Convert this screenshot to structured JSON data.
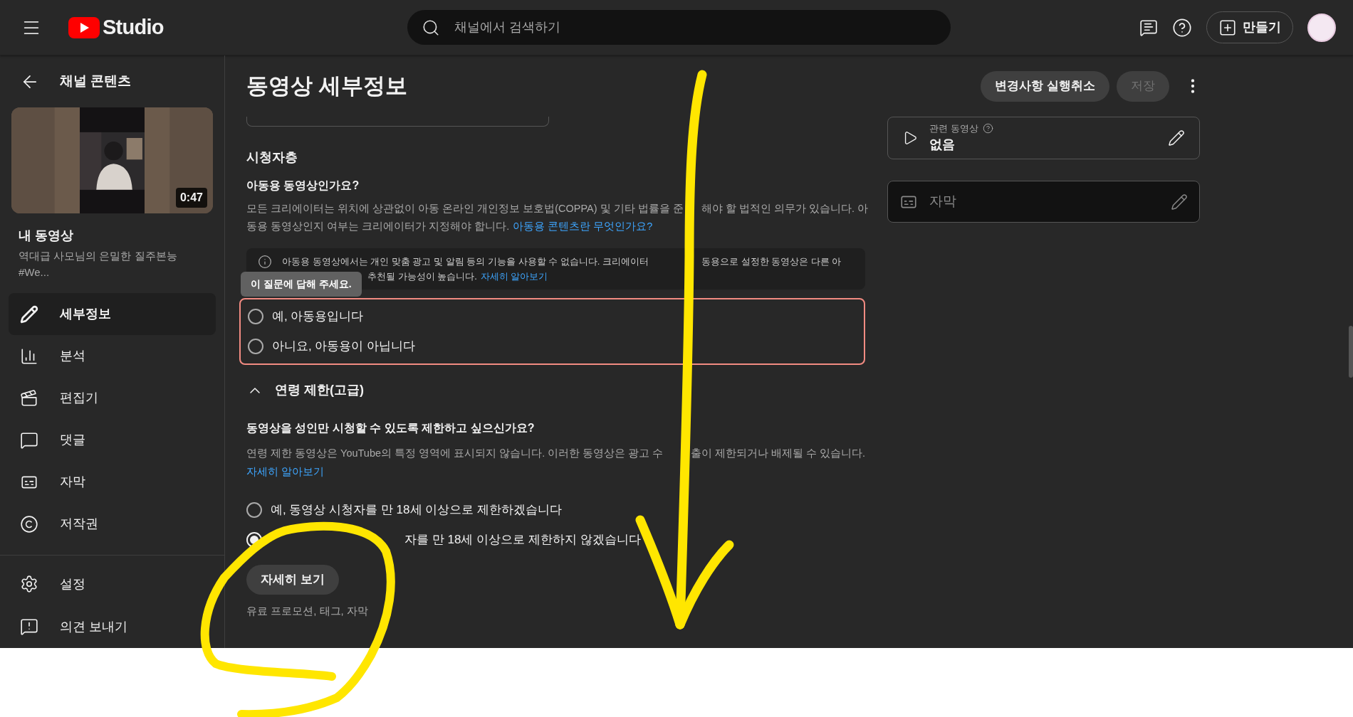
{
  "header": {
    "logo_text": "Studio",
    "search": {
      "placeholder": "채널에서 검색하기"
    },
    "create_button": "만들기"
  },
  "sidebar": {
    "back_label": "채널 콘텐츠",
    "thumbnail": {
      "kind": "picture",
      "duration": "0:47"
    },
    "video_heading": "내 동영상",
    "video_title": "역대급 사모님의 은밀한 질주본능 #We...",
    "nav": [
      {
        "label": "세부정보",
        "selected": true
      },
      {
        "label": "분석",
        "selected": false
      },
      {
        "label": "편집기",
        "selected": false
      },
      {
        "label": "댓글",
        "selected": false
      },
      {
        "label": "자막",
        "selected": false
      },
      {
        "label": "저작권",
        "selected": false
      }
    ],
    "footer_nav": [
      {
        "label": "설정"
      },
      {
        "label": "의견 보내기"
      }
    ]
  },
  "page": {
    "title": "동영상 세부정보",
    "undo_button": "변경사항 실행취소",
    "save_button": {
      "label": "저장",
      "disabled": true
    }
  },
  "audience": {
    "heading": "시청자층",
    "question": "아동용 동영상인가요?",
    "description_parts": [
      "모든 크리에이터는 위치에 상관없이 아동 온라인 개인정보 보호법(COPPA) 및 기타 법률을 준",
      "해야 할 법적인 의무가 있습니다. 아",
      "동용 동영상인지 여부는 크리에이터가 지정해야 합니다."
    ],
    "link": "아동용 콘텐츠란 무엇인가요?",
    "info": {
      "text_parts": [
        "아동용 동영상에서는 개인 맞춤 광고 및 알림 등의 기능을 사용할 수 없습니다. 크리에이터",
        "동용으로 설정한 동영상은 다른 아",
        "추천될 가능성이 높습니다."
      ],
      "link": "자세히 알아보기"
    },
    "tooltip": "이 질문에 답해 주세요.",
    "error": true,
    "options": [
      {
        "label": "예, 아동용입니다",
        "selected": false
      },
      {
        "label": "아니요, 아동용이 아닙니다",
        "selected": false
      }
    ]
  },
  "age_restriction": {
    "heading": "연령 제한(고급)",
    "expanded": true,
    "question": "동영상을 성인만 시청할 수 있도록 제한하고 싶으신가요?",
    "description_parts": [
      "연령 제한 동영상은 YouTube의 특정 영역에 표시되지 않습니다. 이러한 동영상은 광고 수",
      "출이 제한되거나 배제될 수 있습니다."
    ],
    "link": "자세히 알아보기",
    "options": [
      {
        "label": "예, 동영상 시청자를 만 18세 이상으로 제한하겠습니다",
        "selected": false
      },
      {
        "label": "자를 만 18세 이상으로 제한하지 않겠습니다",
        "selected": true
      }
    ]
  },
  "more_button": "자세히 보기",
  "more_hint": "유료 프로모션, 태그, 자막",
  "related_video": {
    "label": "관련 동영상",
    "value": "없음"
  },
  "subtitles": {
    "placeholder": "자막"
  }
}
